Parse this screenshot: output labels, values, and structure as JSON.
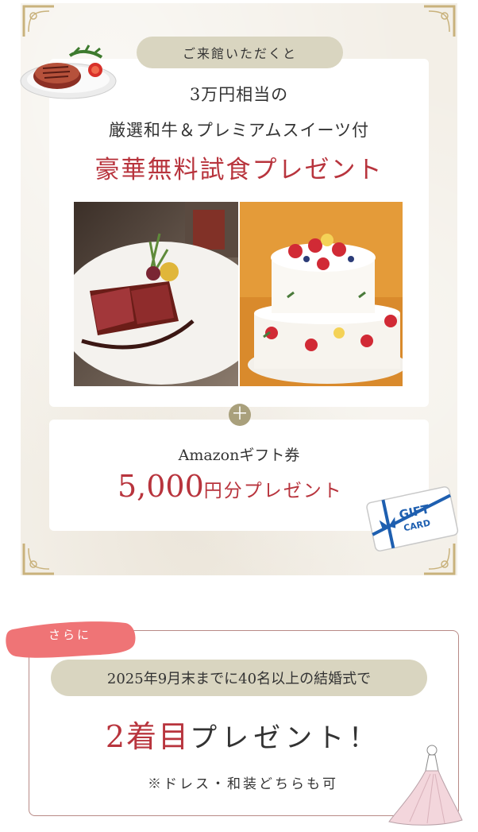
{
  "benefit1": {
    "intro_pill": "ご来館いただくと",
    "line1": "3万円相当の",
    "line2": "厳選和牛＆プレミアムスイーツ付",
    "headline": "豪華無料試食プレゼント",
    "plus": "＋"
  },
  "benefit2": {
    "line": "Amazonギフト券",
    "amount_number": "5,000",
    "amount_suffix": "円分プレゼント",
    "gift_card_text1": "GIFT",
    "gift_card_text2": "CARD"
  },
  "benefit3": {
    "ribbon": "さらに",
    "condition": "2025年9月末までに40名以上の結婚式で",
    "headline_red": "2着目",
    "headline_black": "プレゼント！",
    "note": "※ドレス・和装どちらも可"
  },
  "colors": {
    "accent_red": "#b8343d",
    "pill_beige": "#d9d5c0",
    "panel_bg": "#f3efe7",
    "plus_olive": "#a9a07c",
    "ribbon_pink": "#ef7476",
    "border_rose": "#b88a86"
  }
}
